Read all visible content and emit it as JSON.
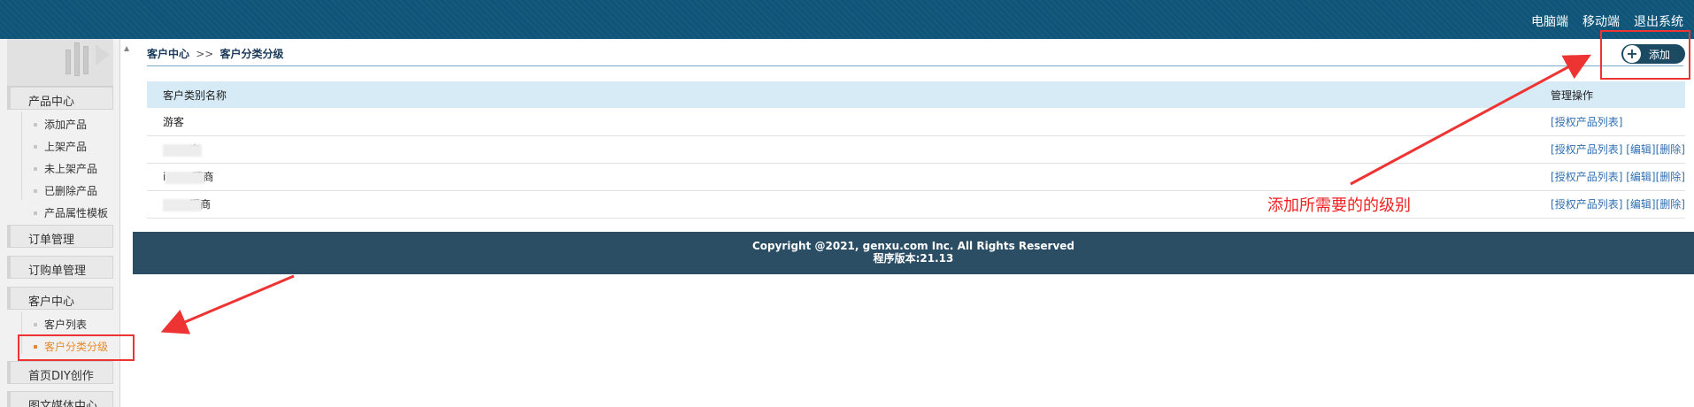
{
  "topbar": {
    "links": [
      "电脑端",
      "移动端",
      "退出系统"
    ]
  },
  "sidebar": {
    "sections": [
      {
        "label": "产品中心",
        "items": [
          "添加产品",
          "上架产品",
          "未上架产品",
          "已删除产品",
          "产品属性模板"
        ]
      },
      {
        "label": "订单管理"
      },
      {
        "label": "订购单管理"
      },
      {
        "label": "客户中心",
        "items": [
          "客户列表",
          "客户分类分级"
        ]
      },
      {
        "label": "首页DIY创作"
      },
      {
        "label": "图文媒体中心"
      }
    ],
    "active_item": "客户分类分级"
  },
  "breadcrumb": {
    "root": "客户中心",
    "sep": ">>",
    "current": "客户分类分级"
  },
  "add_button": {
    "label": "添加"
  },
  "table": {
    "headers": [
      "客户类别名称",
      "管理操作"
    ],
    "rows": [
      {
        "name": "游客",
        "ops": [
          "[授权产品列表]"
        ]
      },
      {
        "name": "商",
        "prefix": "",
        "ops": [
          "[授权产品列表]",
          "[编辑]",
          "[删除]"
        ]
      },
      {
        "name": "理商",
        "prefix": "i",
        "ops": [
          "[授权产品列表]",
          "[编辑]",
          "[删除]"
        ]
      },
      {
        "name": "理商",
        "prefix": "",
        "ops": [
          "[授权产品列表]",
          "[编辑]",
          "[删除]"
        ]
      }
    ]
  },
  "footer": {
    "copyright": "Copyright @2021, genxu.com Inc. All Rights Reserved",
    "version": "程序版本:21.13"
  },
  "annotation": {
    "note": "添加所需要的的级别"
  },
  "colors": {
    "topbar": "#0e5579",
    "footer": "#2b4e64",
    "active": "#e88a2c",
    "annotation": "#e33"
  }
}
